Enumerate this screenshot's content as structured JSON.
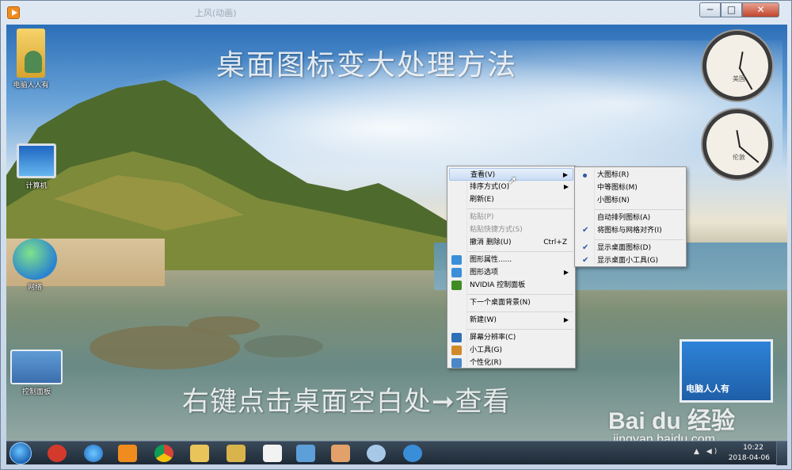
{
  "window": {
    "title": "上风(动画)",
    "buttons": {
      "minimize": "─",
      "maximize": "□",
      "close": "✕"
    }
  },
  "captions": {
    "top": "桌面图标变大处理方法",
    "bottom": "右键点击桌面空白处➞查看"
  },
  "desktop_icons": [
    {
      "label": "电脑人人有",
      "icon": "user-folder-icon"
    },
    {
      "label": "计算机",
      "icon": "computer-icon"
    },
    {
      "label": "网络",
      "icon": "network-globe-icon"
    },
    {
      "label": "控制面板",
      "icon": "control-panel-icon"
    }
  ],
  "clocks": [
    {
      "city": "美国"
    },
    {
      "city": "伦敦"
    }
  ],
  "context_menu": {
    "items": [
      {
        "label": "查看(V)",
        "has_submenu": true,
        "highlighted": true
      },
      {
        "label": "排序方式(O)",
        "has_submenu": true
      },
      {
        "label": "刷新(E)"
      },
      {
        "label": "粘贴(P)",
        "disabled": true
      },
      {
        "label": "粘贴快捷方式(S)",
        "disabled": true
      },
      {
        "label": "撤消 删除(U)",
        "shortcut": "Ctrl+Z"
      },
      {
        "label": "图形属性......",
        "icon": "graphics-properties-icon"
      },
      {
        "label": "图形选项",
        "icon": "graphics-options-icon",
        "has_submenu": true
      },
      {
        "label": "NVIDIA 控制面板",
        "icon": "nvidia-icon"
      },
      {
        "label": "下一个桌面背景(N)"
      },
      {
        "label": "新建(W)",
        "has_submenu": true
      },
      {
        "label": "屏幕分辨率(C)",
        "icon": "screen-resolution-icon"
      },
      {
        "label": "小工具(G)",
        "icon": "gadgets-icon"
      },
      {
        "label": "个性化(R)",
        "icon": "personalize-icon"
      }
    ]
  },
  "view_submenu": {
    "items": [
      {
        "label": "大图标(R)",
        "selected": true
      },
      {
        "label": "中等图标(M)"
      },
      {
        "label": "小图标(N)"
      },
      {
        "label": "自动排列图标(A)"
      },
      {
        "label": "将图标与网格对齐(I)",
        "checked": true
      },
      {
        "label": "显示桌面图标(D)",
        "checked": true
      },
      {
        "label": "显示桌面小工具(G)",
        "checked": true
      }
    ]
  },
  "branding": {
    "box_text": "电脑人人有",
    "logo": "Bai du 经验",
    "url": "jingyan.baidu.com"
  },
  "taskbar": {
    "apps": [
      "start-orb-icon",
      "jiang-app-icon",
      "ie-icon",
      "video-player-icon",
      "chrome-icon",
      "explorer-icon",
      "folder-icon",
      "document-icon",
      "remote-desktop-icon",
      "paint-icon",
      "settings-icon",
      "browser-icon"
    ],
    "time": "10:22",
    "date": "2018-04-06"
  },
  "colors": {
    "menu_bg": "#f0f0f0",
    "highlight": "#c9dcf4",
    "accent": "#2a5aa6",
    "taskbar": "#1e2a36"
  }
}
